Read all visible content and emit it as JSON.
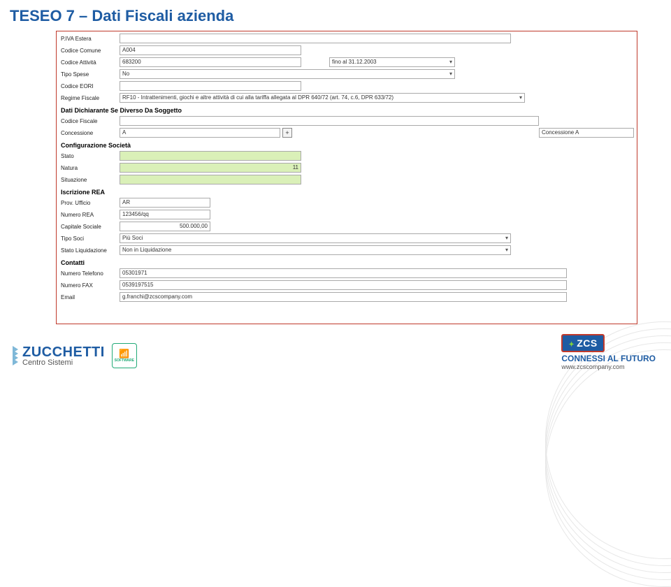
{
  "title": "TESEO 7 – Dati Fiscali azienda",
  "fields": {
    "piva_estera": {
      "label": "P.IVA Estera",
      "value": ""
    },
    "codice_comune": {
      "label": "Codice Comune",
      "value": "A004"
    },
    "codice_attivita": {
      "label": "Codice Attività",
      "value": "683200",
      "period": "fino al 31.12.2003"
    },
    "tipo_spese": {
      "label": "Tipo Spese",
      "value": "No"
    },
    "codice_eori": {
      "label": "Codice EORI",
      "value": ""
    },
    "regime_fiscale": {
      "label": "Regime Fiscale",
      "value": "RF10 - Intrattenimenti, giochi e altre attività di cui alla tariffa allegata al DPR 640/72 (art. 74, c.6, DPR 633/72)"
    }
  },
  "section_dichiarante": {
    "title": "Dati Dichiarante Se Diverso Da Soggetto",
    "codice_fiscale": {
      "label": "Codice Fiscale",
      "value": ""
    },
    "concessione": {
      "label": "Concessione",
      "value": "A",
      "side": "Concessione A"
    }
  },
  "section_conf": {
    "title": "Configurazione Società",
    "stato": {
      "label": "Stato",
      "value": ""
    },
    "natura": {
      "label": "Natura",
      "value": "11"
    },
    "situazione": {
      "label": "Situazione",
      "value": ""
    }
  },
  "section_rea": {
    "title": "Iscrizione REA",
    "prov": {
      "label": "Prov. Ufficio",
      "value": "AR"
    },
    "numero": {
      "label": "Numero REA",
      "value": "123456/qq"
    },
    "capitale": {
      "label": "Capitale Sociale",
      "value": "500.000,00"
    },
    "tipo_soci": {
      "label": "Tipo Soci",
      "value": "Più Soci"
    },
    "stato_liq": {
      "label": "Stato Liquidazione",
      "value": "Non in Liquidazione"
    }
  },
  "section_contatti": {
    "title": "Contatti",
    "tel": {
      "label": "Numero Telefono",
      "value": "05301971"
    },
    "fax": {
      "label": "Numero FAX",
      "value": "0539197515"
    },
    "email": {
      "label": "Email",
      "value": "g.franchi@zcscompany.com"
    }
  },
  "footer": {
    "brand_top": "ZUCCHETTI",
    "brand_bot": "Centro Sistemi",
    "sw": "SOFTWARE",
    "badge": "ZCS",
    "tag1": "CONNESSI AL FUTURO",
    "tag2": "www.zcscompany.com"
  }
}
